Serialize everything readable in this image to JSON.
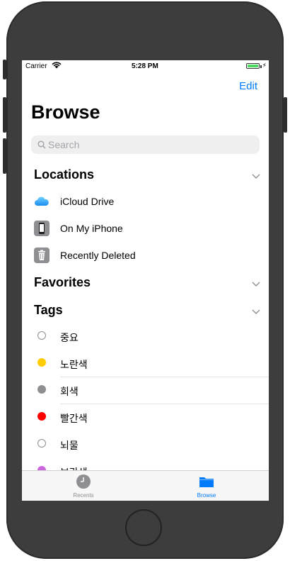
{
  "status_bar": {
    "carrier": "Carrier",
    "time": "5:28 PM"
  },
  "nav": {
    "edit_label": "Edit",
    "title": "Browse"
  },
  "search": {
    "placeholder": "Search"
  },
  "sections": {
    "locations": "Locations",
    "favorites": "Favorites",
    "tags": "Tags"
  },
  "locations": [
    {
      "label": "iCloud Drive",
      "icon": "cloud-icon"
    },
    {
      "label": "On My iPhone",
      "icon": "iphone-icon"
    },
    {
      "label": "Recently Deleted",
      "icon": "trash-icon"
    }
  ],
  "tags": [
    {
      "label": "중요",
      "color": "#ffffff"
    },
    {
      "label": "노란색",
      "color": "#ffcc00"
    },
    {
      "label": "회색",
      "color": "#8e8e93"
    },
    {
      "label": "빨간색",
      "color": "#ff0000"
    },
    {
      "label": "뇌물",
      "color": "#ffffff"
    },
    {
      "label": "보라색",
      "color": "#cc66dd"
    }
  ],
  "tab_bar": {
    "recents": "Recents",
    "browse": "Browse"
  },
  "colors": {
    "accent": "#007aff",
    "battery": "#4cd964"
  }
}
